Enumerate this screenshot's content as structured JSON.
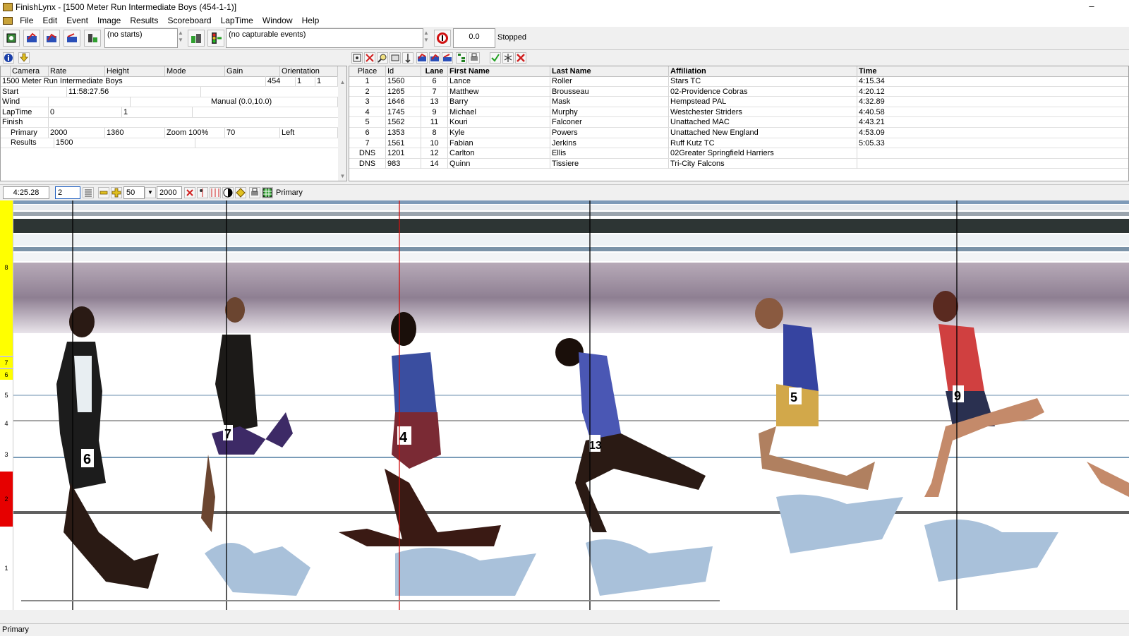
{
  "window": {
    "title": "FinishLynx - [1500 Meter Run Intermediate Boys (454-1-1)]",
    "minimize": "–"
  },
  "menu": [
    {
      "label": "File"
    },
    {
      "label": "Edit"
    },
    {
      "label": "Event"
    },
    {
      "label": "Image"
    },
    {
      "label": "Results"
    },
    {
      "label": "Scoreboard"
    },
    {
      "label": "LapTime"
    },
    {
      "label": "Window"
    },
    {
      "label": "Help"
    }
  ],
  "toolbar": {
    "starts_combo": "(no starts)",
    "events_combo": "(no capturable events)",
    "timer_value": "0.0",
    "status": "Stopped"
  },
  "event_panel": {
    "headers": [
      "Camera",
      "Rate",
      "Height",
      "Mode",
      "Gain",
      "Orientation"
    ],
    "rows": [
      {
        "cells": [
          "1500 Meter Run Intermediate Boys",
          "",
          "",
          "",
          "",
          "454",
          "1",
          "1"
        ]
      },
      {
        "cells": [
          "Start",
          "11:58:27.56"
        ]
      },
      {
        "cells": [
          "Wind",
          "",
          "Manual (0.0,10.0)"
        ]
      },
      {
        "cells": [
          "LapTime",
          "0",
          "1"
        ]
      },
      {
        "cells": [
          "Finish"
        ]
      },
      {
        "cells": [
          "Primary",
          "2000",
          "1360",
          "Zoom 100%",
          "70",
          "Left"
        ]
      },
      {
        "cells": [
          "Results",
          "1500"
        ]
      }
    ]
  },
  "results": {
    "headers": [
      "Place",
      "Id",
      "Lane",
      "First Name",
      "Last Name",
      "Affiliation",
      "Time"
    ],
    "rows": [
      [
        "1",
        "1560",
        "6",
        "Lance",
        "Roller",
        "Stars TC",
        "4:15.34"
      ],
      [
        "2",
        "1265",
        "7",
        "Matthew",
        "Brousseau",
        "02-Providence Cobras",
        "4:20.12"
      ],
      [
        "3",
        "1646",
        "13",
        "Barry",
        "Mask",
        "Hempstead PAL",
        "4:32.89"
      ],
      [
        "4",
        "1745",
        "9",
        "Michael",
        "Murphy",
        "Westchester Striders",
        "4:40.58"
      ],
      [
        "5",
        "1562",
        "11",
        "Kouri",
        "Falconer",
        "Unattached MAC",
        "4:43.21"
      ],
      [
        "6",
        "1353",
        "8",
        "Kyle",
        "Powers",
        "Unattached New England",
        "4:53.09"
      ],
      [
        "7",
        "1561",
        "10",
        "Fabian",
        "Jerkins",
        "Ruff Kutz TC",
        "5:05.33"
      ],
      [
        "DNS",
        "1201",
        "12",
        "Carlton",
        "Ellis",
        "02Greater Springfield Harriers",
        ""
      ],
      [
        "DNS",
        "983",
        "14",
        "Quinn",
        "Tissiere",
        "Tri-City Falcons",
        ""
      ]
    ]
  },
  "image_toolbar": {
    "cursor_time": "4:25.28",
    "zoom_field": "2",
    "density": "50",
    "width_field": "2000",
    "view_name": "Primary"
  },
  "image": {
    "lane_labels": [
      "8",
      "7",
      "6",
      "5",
      "4",
      "3",
      "2",
      "1"
    ],
    "bib_numbers": [
      "6",
      "7",
      "4",
      "13",
      "5",
      "9"
    ]
  },
  "statusbar": {
    "text": "Primary"
  }
}
